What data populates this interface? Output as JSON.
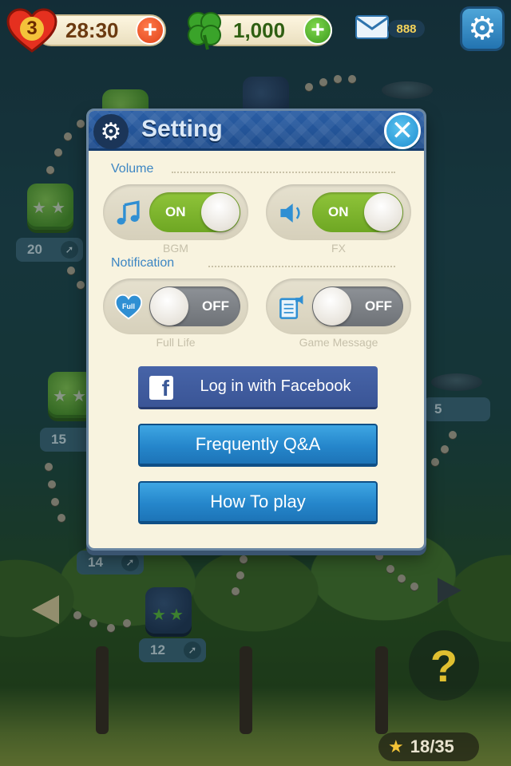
{
  "hud": {
    "lives": "3",
    "timer": "28:30",
    "clovers": "1,000",
    "mail_count": "888",
    "lives_plus_label": "+",
    "clovers_plus_label": "+"
  },
  "map": {
    "levels": [
      {
        "label": "20"
      },
      {
        "label": "15"
      },
      {
        "label": "14"
      },
      {
        "label": "12"
      },
      {
        "label": "5"
      }
    ]
  },
  "dialog": {
    "title": "Setting",
    "close_label": "✕",
    "sections": {
      "volume": "Volume",
      "notification": "Notification"
    },
    "toggles": [
      {
        "caption": "BGM",
        "state": "ON",
        "icon": "music-note-icon"
      },
      {
        "caption": "FX",
        "state": "ON",
        "icon": "speaker-icon"
      },
      {
        "caption": "Full Life",
        "state": "OFF",
        "icon": "full-life-heart-icon",
        "icon_text": "Full"
      },
      {
        "caption": "Game Message",
        "state": "OFF",
        "icon": "game-message-icon"
      }
    ],
    "buttons": {
      "facebook": "Log in with Facebook",
      "faq": "Frequently Q&A",
      "how_to_play": "How To play"
    }
  },
  "bottom": {
    "help_label": "?",
    "stars": "18/35"
  },
  "colors": {
    "accent_blue": "#2586cb",
    "toggle_on": "#8fc43a",
    "toggle_off": "#8e9297",
    "facebook": "#3b5998",
    "dialog_bg": "#f8f3df"
  }
}
